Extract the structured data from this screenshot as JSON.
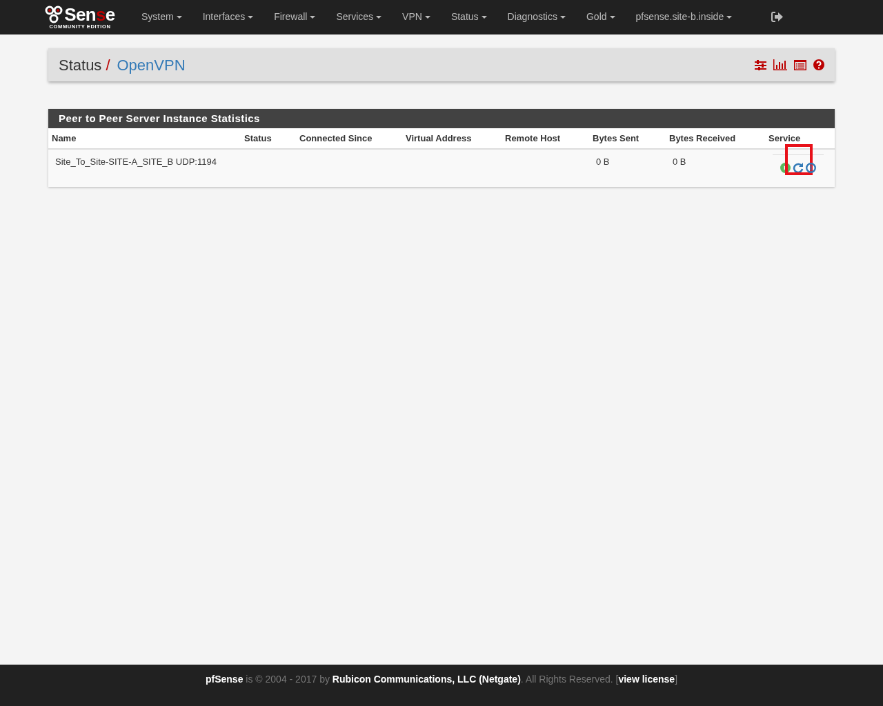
{
  "navbar": {
    "logo": {
      "word_start": "Sen",
      "word_accent": "s",
      "word_end": "e",
      "subtitle": "COMMUNITY EDITION"
    },
    "menus": [
      {
        "label": "System"
      },
      {
        "label": "Interfaces"
      },
      {
        "label": "Firewall"
      },
      {
        "label": "Services"
      },
      {
        "label": "VPN"
      },
      {
        "label": "Status"
      },
      {
        "label": "Diagnostics"
      },
      {
        "label": "Gold"
      },
      {
        "label": "pfsense.site-b.inside"
      }
    ]
  },
  "breadcrumb": {
    "parent": "Status",
    "separator": "/",
    "current": "OpenVPN"
  },
  "panel": {
    "title": "Peer to Peer Server Instance Statistics",
    "columns": [
      "Name",
      "Status",
      "Connected Since",
      "Virtual Address",
      "Remote Host",
      "Bytes Sent",
      "Bytes Received",
      "Service"
    ],
    "rows": [
      {
        "name": "Site_To_Site-SITE-A_SITE_B UDP:1194",
        "bytes_sent": "0 B",
        "bytes_received": "0 B",
        "actions": [
          {
            "kind": "start",
            "highlighted": false
          },
          {
            "kind": "restart",
            "highlighted": true
          },
          {
            "kind": "stop",
            "highlighted": false
          }
        ]
      }
    ]
  },
  "footer": {
    "text": "**pfSense** is © 2004 - 2017 by **Rubicon Communications, LLC (Netgate)**. All Rights Reserved. [",
    "link": "view license",
    "text_end": "]"
  }
}
